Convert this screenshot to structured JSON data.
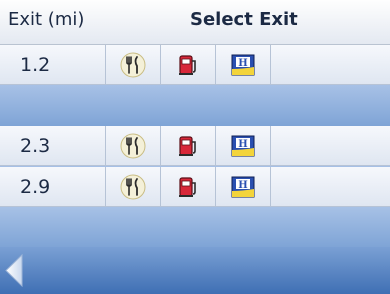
{
  "header": {
    "exit_label": "Exit (mi)",
    "title": "Select Exit"
  },
  "rows": [
    {
      "exit": "1.2"
    },
    {
      "exit": "2.3"
    },
    {
      "exit": "2.9"
    }
  ],
  "icons": {
    "food": "fork-knife-icon",
    "gas": "gas-pump-icon",
    "lodging": "hotel-icon",
    "back": "back-arrow-icon"
  },
  "colors": {
    "header_bg": "#f3f6fa",
    "band_bg": "#8fb3e0",
    "footer_bg": "#5b86c4",
    "text": "#1c2a44",
    "gas_red": "#d8283a",
    "hotel_blue": "#2a4fb0",
    "hotel_yellow": "#f3d43b"
  }
}
